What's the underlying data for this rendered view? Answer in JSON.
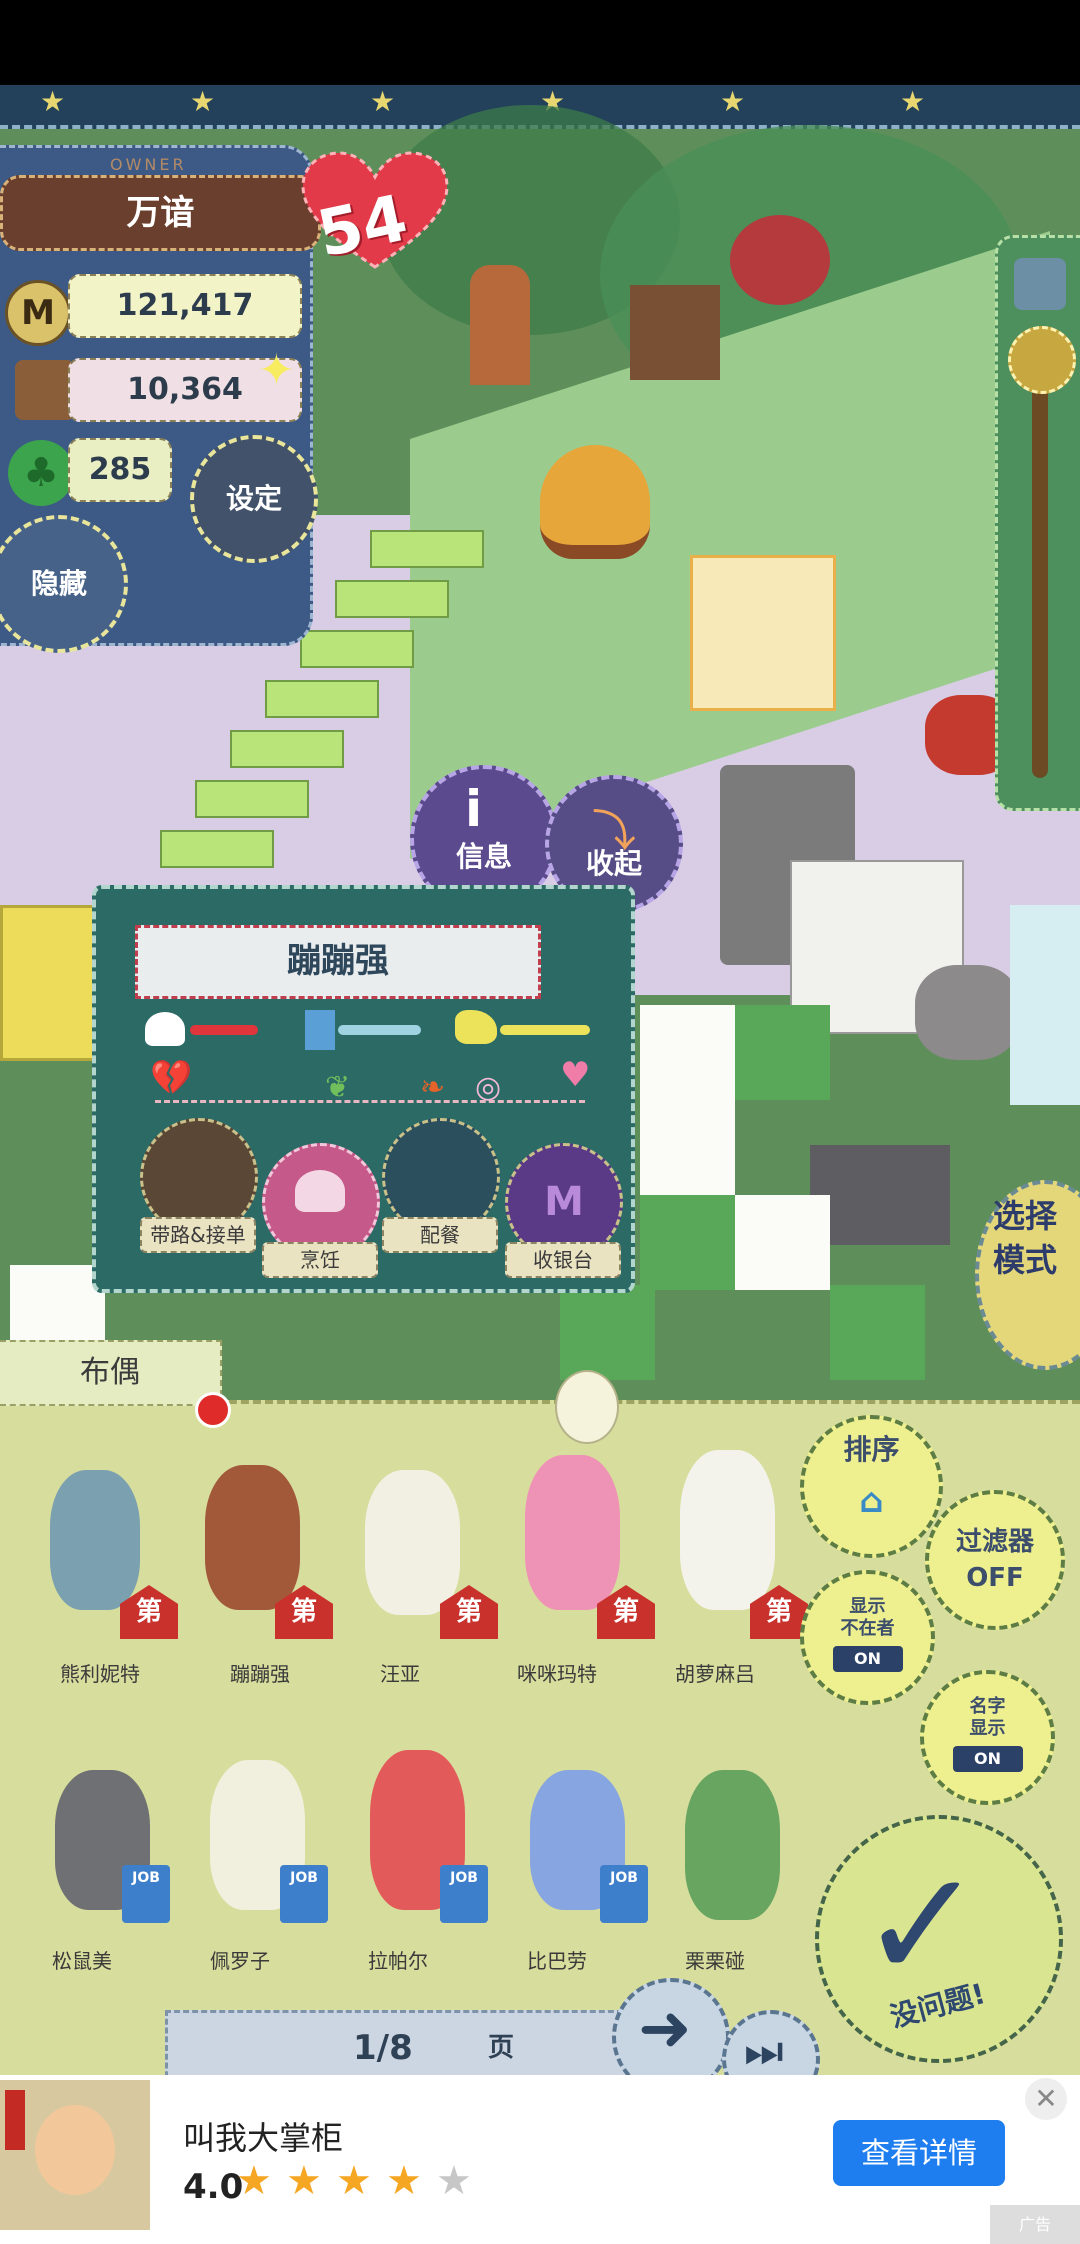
{
  "owner": {
    "label_small": "OWNER",
    "name": "万谙",
    "hearts": "54",
    "money": "121,417",
    "money_icon": "M",
    "food": "10,364",
    "clover": "285",
    "settings": "设定",
    "hide": "隐藏"
  },
  "popup": {
    "info": "信息",
    "collapse": "收起"
  },
  "bear": {
    "name": "蹦蹦强",
    "roles": [
      "带路&接单",
      "烹饪",
      "配餐",
      "收银台"
    ],
    "cashier_icon": "M",
    "stats": [
      {
        "skill": "cooking",
        "level": 0.45,
        "color": "#e0363b"
      },
      {
        "skill": "serving",
        "level": 0.55,
        "color": "#9fd3e2"
      },
      {
        "skill": "cashier",
        "level": 0.6,
        "color": "#ece35a"
      }
    ]
  },
  "select_mode": "选择\n模式",
  "roster": {
    "tab": "布偶",
    "row1": [
      {
        "name": "熊利妮特",
        "tag": "第"
      },
      {
        "name": "蹦蹦强",
        "tag": "第"
      },
      {
        "name": "汪亚",
        "tag": "第"
      },
      {
        "name": "咪咪玛特",
        "tag": "第"
      },
      {
        "name": "胡萝麻吕",
        "tag": "第"
      }
    ],
    "row2": [
      {
        "name": "松鼠美",
        "tag": "JOB"
      },
      {
        "name": "佩罗子",
        "tag": "JOB"
      },
      {
        "name": "拉帕尔",
        "tag": "JOB"
      },
      {
        "name": "比巴劳",
        "tag": "JOB"
      },
      {
        "name": "栗栗碰",
        "tag": ""
      }
    ],
    "page": "1/8",
    "page_suffix": "页"
  },
  "side_buttons": {
    "sort": "排序",
    "filter": "过滤器",
    "filter_state": "OFF",
    "show_absent": "显示\n不在者",
    "show_absent_state": "ON",
    "show_name": "名字\n显示",
    "show_name_state": "ON",
    "ok": "没问题!"
  },
  "ad": {
    "title": "叫我大掌柜",
    "rating": "4.0",
    "stars_filled": 4,
    "cta": "查看详情",
    "close": "✕",
    "corner": "广告"
  }
}
